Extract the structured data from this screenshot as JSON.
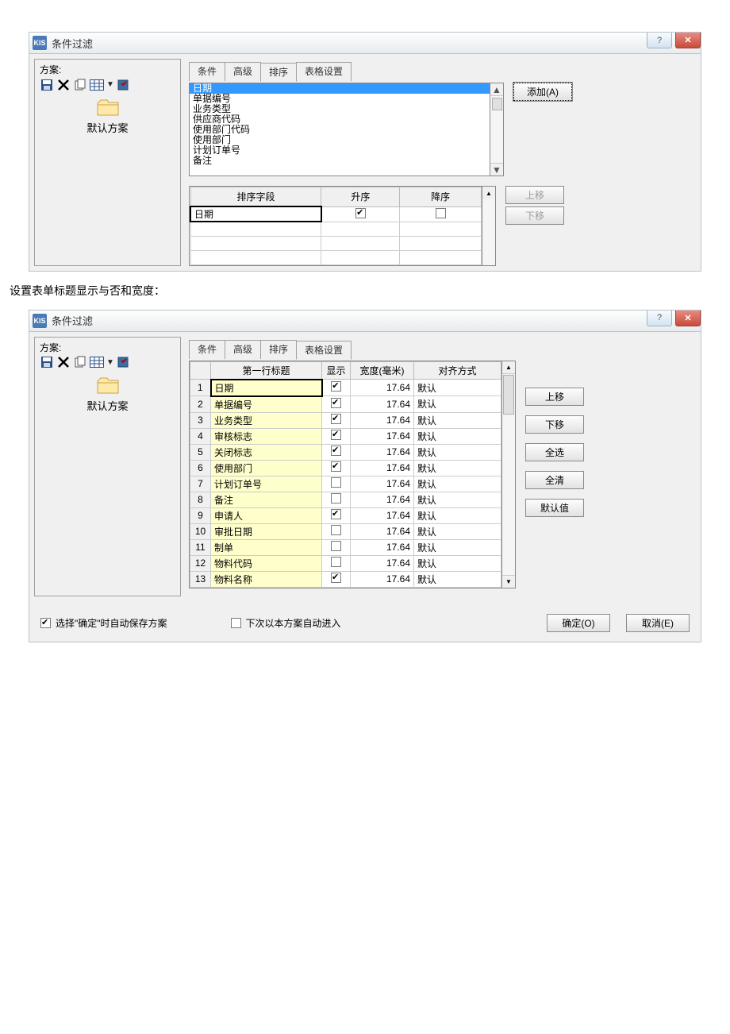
{
  "dialog1": {
    "app_icon": "KIS",
    "title": "条件过滤",
    "help_symbol": "?",
    "close_symbol": "✕",
    "left": {
      "scheme_label": "方案:",
      "scheme_name": "默认方案"
    },
    "tabs": {
      "t0": "条件",
      "t1": "高级",
      "t2": "排序",
      "t3": "表格设置"
    },
    "listbox": [
      "日期",
      "单据编号",
      "业务类型",
      "供应商代码",
      "使用部门代码",
      "使用部门",
      "计划订单号",
      "备注"
    ],
    "add_btn": "添加(A)",
    "moveup_btn": "上移",
    "movedown_btn": "下移",
    "sort_headers": {
      "field": "排序字段",
      "asc": "升序",
      "desc": "降序"
    },
    "sort_rows": [
      {
        "field": "日期",
        "asc": true,
        "desc": false
      }
    ]
  },
  "caption_between": "设置表单标题显示与否和宽度：",
  "dialog2": {
    "app_icon": "KIS",
    "title": "条件过滤",
    "help_symbol": "?",
    "close_symbol": "✕",
    "left": {
      "scheme_label": "方案:",
      "scheme_name": "默认方案"
    },
    "tabs": {
      "t0": "条件",
      "t1": "高级",
      "t2": "排序",
      "t3": "表格设置"
    },
    "fields_headers": {
      "title": "第一行标题",
      "show": "显示",
      "width": "宽度(毫米)",
      "align": "对齐方式"
    },
    "fields_rows": [
      {
        "n": 1,
        "title": "日期",
        "show": true,
        "width": "17.64",
        "align": "默认"
      },
      {
        "n": 2,
        "title": "单据编号",
        "show": true,
        "width": "17.64",
        "align": "默认"
      },
      {
        "n": 3,
        "title": "业务类型",
        "show": true,
        "width": "17.64",
        "align": "默认"
      },
      {
        "n": 4,
        "title": "审核标志",
        "show": true,
        "width": "17.64",
        "align": "默认"
      },
      {
        "n": 5,
        "title": "关闭标志",
        "show": true,
        "width": "17.64",
        "align": "默认"
      },
      {
        "n": 6,
        "title": "使用部门",
        "show": true,
        "width": "17.64",
        "align": "默认"
      },
      {
        "n": 7,
        "title": "计划订单号",
        "show": false,
        "width": "17.64",
        "align": "默认"
      },
      {
        "n": 8,
        "title": "备注",
        "show": false,
        "width": "17.64",
        "align": "默认"
      },
      {
        "n": 9,
        "title": "申请人",
        "show": true,
        "width": "17.64",
        "align": "默认"
      },
      {
        "n": 10,
        "title": "审批日期",
        "show": false,
        "width": "17.64",
        "align": "默认"
      },
      {
        "n": 11,
        "title": "制单",
        "show": false,
        "width": "17.64",
        "align": "默认"
      },
      {
        "n": 12,
        "title": "物料代码",
        "show": false,
        "width": "17.64",
        "align": "默认"
      },
      {
        "n": 13,
        "title": "物料名称",
        "show": true,
        "width": "17.64",
        "align": "默认"
      }
    ],
    "side": {
      "moveup": "上移",
      "movedown": "下移",
      "selall": "全选",
      "clrall": "全清",
      "default": "默认值"
    },
    "footer": {
      "autosave_label": "选择\"确定\"时自动保存方案",
      "autosave_checked": true,
      "autoopen_label": "下次以本方案自动进入",
      "autoopen_checked": false,
      "ok": "确定(O)",
      "cancel": "取消(E)"
    }
  }
}
